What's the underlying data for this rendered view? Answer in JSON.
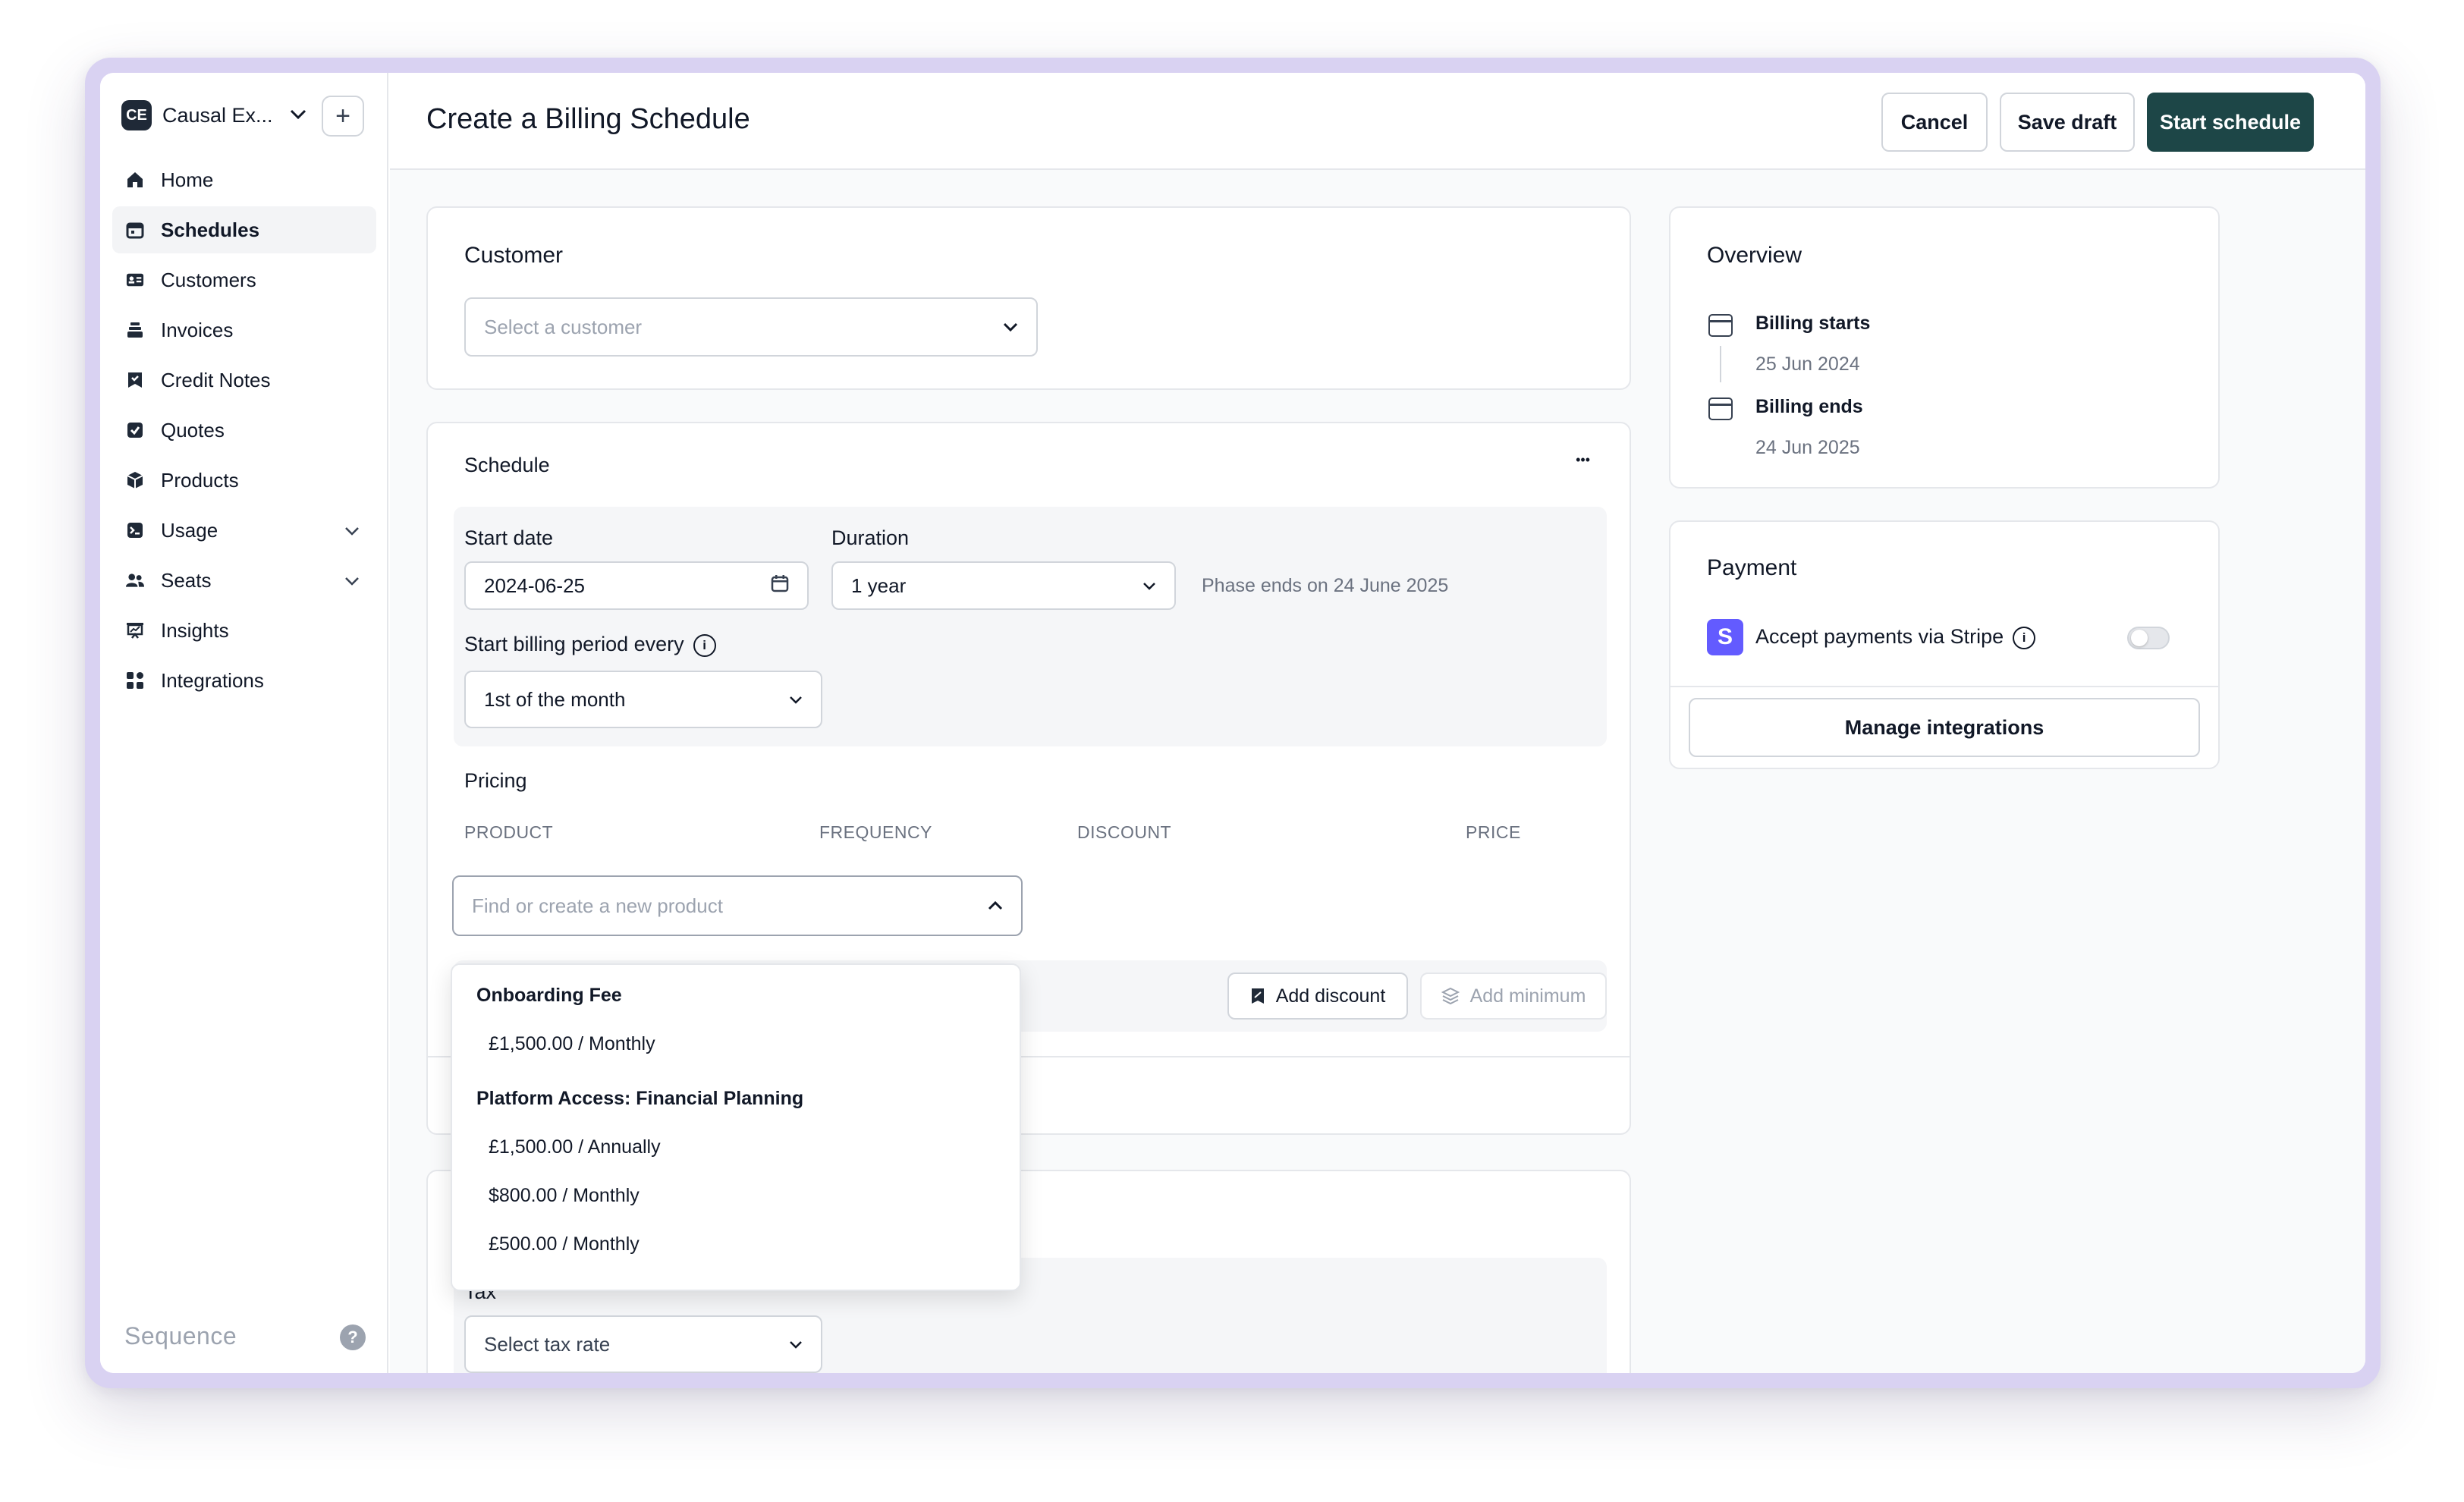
{
  "workspace": {
    "badge": "CE",
    "name": "Causal Ex..."
  },
  "sidebar": {
    "items": [
      {
        "label": "Home",
        "icon": "home-icon"
      },
      {
        "label": "Schedules",
        "icon": "calendar-icon",
        "active": true
      },
      {
        "label": "Customers",
        "icon": "id-card-icon"
      },
      {
        "label": "Invoices",
        "icon": "stack-icon"
      },
      {
        "label": "Credit Notes",
        "icon": "receipt-icon"
      },
      {
        "label": "Quotes",
        "icon": "check-square-icon"
      },
      {
        "label": "Products",
        "icon": "cube-icon"
      },
      {
        "label": "Usage",
        "icon": "terminal-icon",
        "expandable": true
      },
      {
        "label": "Seats",
        "icon": "users-icon",
        "expandable": true
      },
      {
        "label": "Insights",
        "icon": "chart-icon"
      },
      {
        "label": "Integrations",
        "icon": "grid-icon"
      }
    ],
    "brand": "Sequence",
    "help": "?"
  },
  "header": {
    "title": "Create a Billing Schedule",
    "cancel": "Cancel",
    "save_draft": "Save draft",
    "start": "Start schedule"
  },
  "customer": {
    "title": "Customer",
    "placeholder": "Select a customer"
  },
  "schedule": {
    "title": "Schedule",
    "more": "•••",
    "start_date_label": "Start date",
    "start_date": "2024-06-25",
    "duration_label": "Duration",
    "duration": "1 year",
    "phase_ends": "Phase ends on 24 June 2025",
    "billing_period_label": "Start billing period every",
    "billing_period": "1st of the month"
  },
  "pricing": {
    "title": "Pricing",
    "columns": [
      "PRODUCT",
      "FREQUENCY",
      "DISCOUNT",
      "PRICE"
    ],
    "search_placeholder": "Find or create a new product",
    "add_discount": "Add discount",
    "add_minimum": "Add minimum"
  },
  "dropdown": {
    "groups": [
      {
        "name": "Onboarding Fee",
        "prices": [
          "£1,500.00 / Monthly"
        ]
      },
      {
        "name": "Platform Access: Financial Planning",
        "prices": [
          "£1,500.00 / Annually",
          "$800.00 / Monthly",
          "£500.00 / Monthly"
        ]
      }
    ]
  },
  "tax": {
    "label": "Tax",
    "placeholder": "Select tax rate"
  },
  "overview": {
    "title": "Overview",
    "billing_starts_label": "Billing starts",
    "billing_starts": "25 Jun 2024",
    "billing_ends_label": "Billing ends",
    "billing_ends": "24 Jun 2025"
  },
  "payment": {
    "title": "Payment",
    "stripe_badge": "S",
    "stripe_label": "Accept payments via Stripe",
    "manage": "Manage integrations"
  }
}
